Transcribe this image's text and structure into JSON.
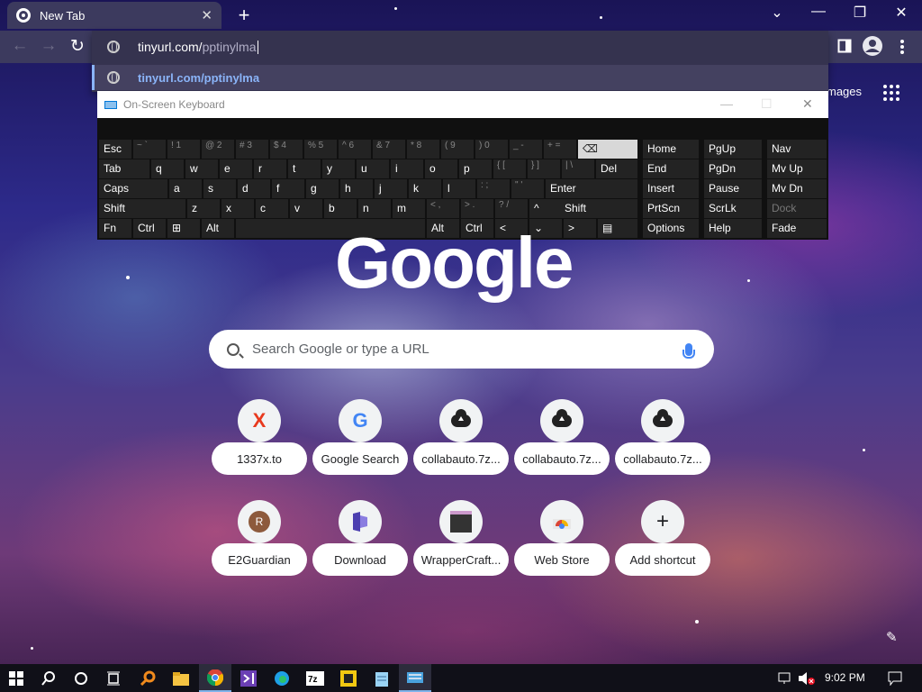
{
  "browser": {
    "tab_title": "New Tab",
    "tab_close": "✕",
    "new_tab": "+",
    "window_controls": [
      "⌄",
      "—",
      "❐",
      "✕"
    ],
    "nav": {
      "back": "←",
      "forward": "→",
      "reload": "↻"
    },
    "omnibox": {
      "typed": "tinyurl.com/",
      "rest": "pptinylma"
    },
    "suggestion": "tinyurl.com/pptinylma",
    "images_link": "mages"
  },
  "osk": {
    "title": "On-Screen Keyboard",
    "title_controls": [
      "—",
      "☐",
      "✕"
    ],
    "rows": [
      [
        "Esc",
        "~ `",
        "! 1",
        "@ 2",
        "# 3",
        "$ 4",
        "% 5",
        "^ 6",
        "& 7",
        "* 8",
        "( 9",
        ") 0",
        "_ -",
        "+ =",
        "⌫"
      ],
      [
        "Tab",
        "q",
        "w",
        "e",
        "r",
        "t",
        "y",
        "u",
        "i",
        "o",
        "p",
        "{ [",
        "} ]",
        "| \\",
        "Del"
      ],
      [
        "Caps",
        "a",
        "s",
        "d",
        "f",
        "g",
        "h",
        "j",
        "k",
        "l",
        ": ;",
        "\" '",
        "Enter"
      ],
      [
        "Shift",
        "z",
        "x",
        "c",
        "v",
        "b",
        "n",
        "m",
        "< ,",
        "> .",
        "? /",
        "^",
        "Shift"
      ],
      [
        "Fn",
        "Ctrl",
        "⊞",
        "Alt",
        "",
        "Alt",
        "Ctrl",
        "<",
        "⌄",
        ">",
        "▤"
      ]
    ],
    "nav_cols": [
      [
        "Home",
        "PgUp",
        "Nav"
      ],
      [
        "End",
        "PgDn",
        "Mv Up"
      ],
      [
        "Insert",
        "Pause",
        "Mv Dn"
      ],
      [
        "PrtScn",
        "ScrLk",
        "Dock"
      ],
      [
        "Options",
        "Help",
        "Fade"
      ]
    ]
  },
  "google": {
    "logo": "Google",
    "search_placeholder": "Search Google or type a URL",
    "shortcuts": [
      {
        "label": "1337x.to",
        "icon": "x-logo-icon"
      },
      {
        "label": "Google Search",
        "icon": "google-g-icon"
      },
      {
        "label": "collabauto.7z...",
        "icon": "cloud-upload-icon"
      },
      {
        "label": "collabauto.7z...",
        "icon": "cloud-upload-icon"
      },
      {
        "label": "collabauto.7z...",
        "icon": "cloud-upload-icon"
      },
      {
        "label": "E2Guardian",
        "icon": "r-avatar-icon"
      },
      {
        "label": "Download",
        "icon": "download-logo-icon"
      },
      {
        "label": "WrapperCraft...",
        "icon": "wrappercraft-icon"
      },
      {
        "label": "Web Store",
        "icon": "webstore-icon"
      },
      {
        "label": "Add shortcut",
        "icon": "plus-icon"
      }
    ],
    "r_letter": "R",
    "x_letter": "X",
    "g_letter": "G",
    "plus": "+"
  },
  "taskbar": {
    "time": "9:02 PM"
  },
  "colors": {
    "accent": "#8ab4f8",
    "toolbar": "#3c3a5e",
    "osk_key": "#232323",
    "osk_highlight": "#d8d8d8"
  }
}
